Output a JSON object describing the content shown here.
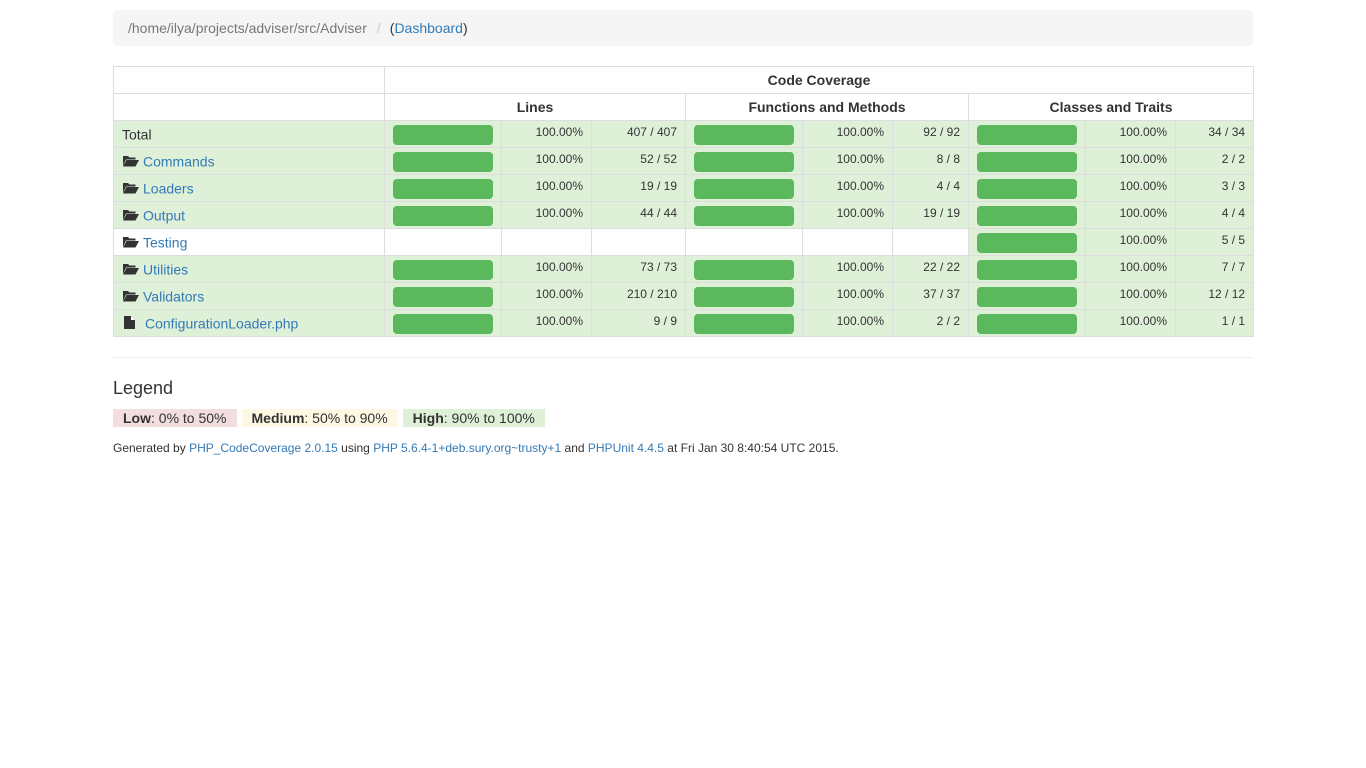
{
  "breadcrumb": {
    "path": "/home/ilya/projects/adviser/src/Adviser",
    "separator": "/",
    "open_paren": "(",
    "dashboard_link": "Dashboard",
    "close_paren": ")"
  },
  "table": {
    "header_title": "Code Coverage",
    "groups": [
      "Lines",
      "Functions and Methods",
      "Classes and Traits"
    ],
    "rows": [
      {
        "name": "Total",
        "type": "total",
        "lines": {
          "pct": "100.00%",
          "count": "407 / 407",
          "fill": 100
        },
        "funcs": {
          "pct": "100.00%",
          "count": "92 / 92",
          "fill": 100
        },
        "classes": {
          "pct": "100.00%",
          "count": "34 / 34",
          "fill": 100
        }
      },
      {
        "name": "Commands",
        "type": "folder",
        "lines": {
          "pct": "100.00%",
          "count": "52 / 52",
          "fill": 100
        },
        "funcs": {
          "pct": "100.00%",
          "count": "8 / 8",
          "fill": 100
        },
        "classes": {
          "pct": "100.00%",
          "count": "2 / 2",
          "fill": 100
        }
      },
      {
        "name": "Loaders",
        "type": "folder",
        "lines": {
          "pct": "100.00%",
          "count": "19 / 19",
          "fill": 100
        },
        "funcs": {
          "pct": "100.00%",
          "count": "4 / 4",
          "fill": 100
        },
        "classes": {
          "pct": "100.00%",
          "count": "3 / 3",
          "fill": 100
        }
      },
      {
        "name": "Output",
        "type": "folder",
        "lines": {
          "pct": "100.00%",
          "count": "44 / 44",
          "fill": 100
        },
        "funcs": {
          "pct": "100.00%",
          "count": "19 / 19",
          "fill": 100
        },
        "classes": {
          "pct": "100.00%",
          "count": "4 / 4",
          "fill": 100
        }
      },
      {
        "name": "Testing",
        "type": "folder",
        "lines": null,
        "funcs": null,
        "classes": {
          "pct": "100.00%",
          "count": "5 / 5",
          "fill": 100
        }
      },
      {
        "name": "Utilities",
        "type": "folder",
        "lines": {
          "pct": "100.00%",
          "count": "73 / 73",
          "fill": 100
        },
        "funcs": {
          "pct": "100.00%",
          "count": "22 / 22",
          "fill": 100
        },
        "classes": {
          "pct": "100.00%",
          "count": "7 / 7",
          "fill": 100
        }
      },
      {
        "name": "Validators",
        "type": "folder",
        "lines": {
          "pct": "100.00%",
          "count": "210 / 210",
          "fill": 100
        },
        "funcs": {
          "pct": "100.00%",
          "count": "37 / 37",
          "fill": 100
        },
        "classes": {
          "pct": "100.00%",
          "count": "12 / 12",
          "fill": 100
        }
      },
      {
        "name": "ConfigurationLoader.php",
        "type": "file",
        "lines": {
          "pct": "100.00%",
          "count": "9 / 9",
          "fill": 100
        },
        "funcs": {
          "pct": "100.00%",
          "count": "2 / 2",
          "fill": 100
        },
        "classes": {
          "pct": "100.00%",
          "count": "1 / 1",
          "fill": 100
        }
      }
    ]
  },
  "legend": {
    "title": "Legend",
    "low_label": "Low",
    "low_range": ": 0% to 50%",
    "medium_label": "Medium",
    "medium_range": ": 50% to 90%",
    "high_label": "High",
    "high_range": ": 90% to 100%"
  },
  "footer": {
    "generated_by": "Generated by ",
    "tool_link": "PHP_CodeCoverage 2.0.15",
    "using": " using ",
    "php_link": "PHP 5.6.4-1+deb.sury.org~trusty+1",
    "and": " and ",
    "phpunit_link": "PHPUnit 4.4.5",
    "at": " at Fri Jan 30 8:40:54 UTC 2015."
  },
  "colors": {
    "high_bg": "#dff0d8",
    "bar_fill": "#5cb85c",
    "link": "#337ab7"
  },
  "icons": {
    "folder": "folder-open-icon",
    "file": "file-icon"
  }
}
